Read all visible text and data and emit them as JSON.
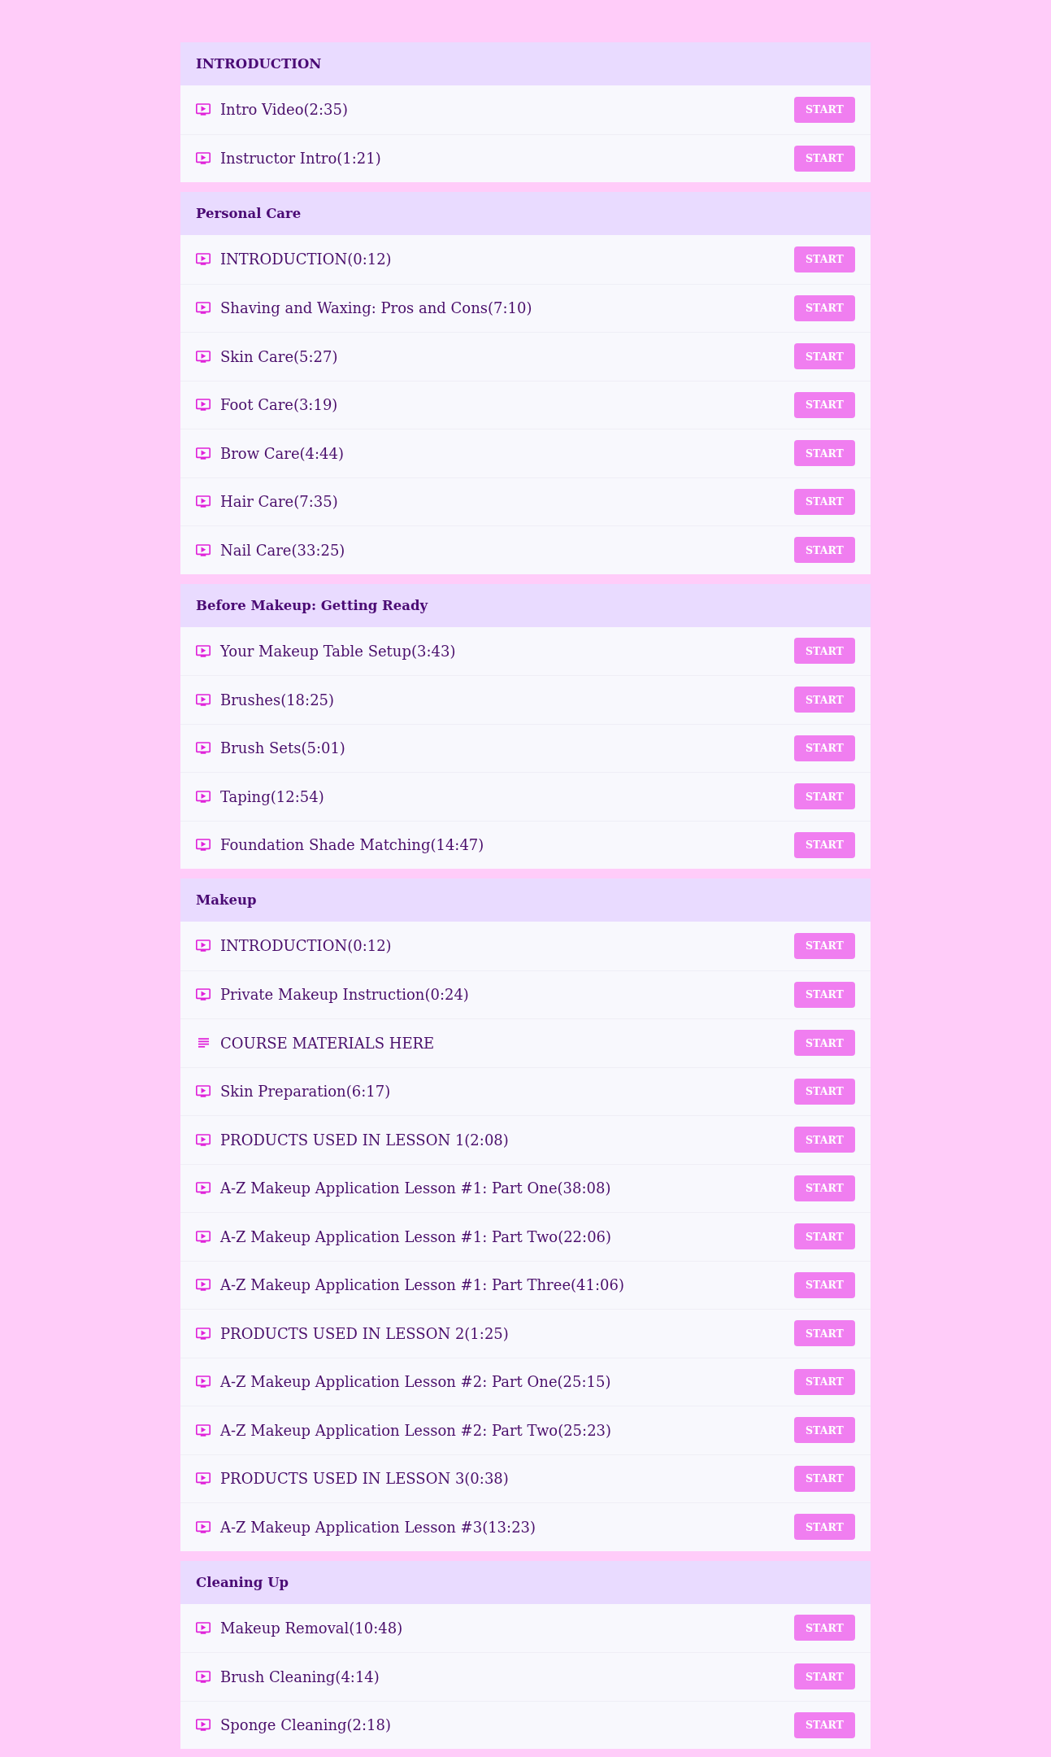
{
  "sections": [
    {
      "title": "INTRODUCTION",
      "lessons": [
        {
          "kind": "video",
          "title": "Intro Video(2:35)",
          "button": "START"
        },
        {
          "kind": "video",
          "title": "Instructor Intro(1:21)",
          "button": "START"
        }
      ]
    },
    {
      "title": "Personal Care",
      "lessons": [
        {
          "kind": "video",
          "title": "INTRODUCTION(0:12)",
          "button": "START"
        },
        {
          "kind": "video",
          "title": "Shaving and Waxing: Pros and Cons(7:10)",
          "button": "START"
        },
        {
          "kind": "video",
          "title": "Skin Care(5:27)",
          "button": "START"
        },
        {
          "kind": "video",
          "title": "Foot Care(3:19)",
          "button": "START"
        },
        {
          "kind": "video",
          "title": "Brow Care(4:44)",
          "button": "START"
        },
        {
          "kind": "video",
          "title": "Hair Care(7:35)",
          "button": "START"
        },
        {
          "kind": "video",
          "title": "Nail Care(33:25)",
          "button": "START"
        }
      ]
    },
    {
      "title": "Before Makeup: Getting Ready",
      "lessons": [
        {
          "kind": "video",
          "title": "Your Makeup Table Setup(3:43)",
          "button": "START"
        },
        {
          "kind": "video",
          "title": "Brushes(18:25)",
          "button": "START"
        },
        {
          "kind": "video",
          "title": "Brush Sets(5:01)",
          "button": "START"
        },
        {
          "kind": "video",
          "title": "Taping(12:54)",
          "button": "START"
        },
        {
          "kind": "video",
          "title": "Foundation Shade Matching(14:47)",
          "button": "START"
        }
      ]
    },
    {
      "title": "Makeup",
      "lessons": [
        {
          "kind": "video",
          "title": "INTRODUCTION(0:12)",
          "button": "START"
        },
        {
          "kind": "video",
          "title": "Private Makeup Instruction(0:24)",
          "button": "START"
        },
        {
          "kind": "text",
          "title": "COURSE MATERIALS HERE",
          "button": "START"
        },
        {
          "kind": "video",
          "title": "Skin Preparation(6:17)",
          "button": "START"
        },
        {
          "kind": "video",
          "title": "PRODUCTS USED IN LESSON 1(2:08)",
          "button": "START"
        },
        {
          "kind": "video",
          "title": "A-Z Makeup Application Lesson #1: Part One(38:08)",
          "button": "START"
        },
        {
          "kind": "video",
          "title": "A-Z Makeup Application Lesson #1: Part Two(22:06)",
          "button": "START"
        },
        {
          "kind": "video",
          "title": "A-Z Makeup Application Lesson #1: Part Three(41:06)",
          "button": "START"
        },
        {
          "kind": "video",
          "title": "PRODUCTS USED IN LESSON 2(1:25)",
          "button": "START"
        },
        {
          "kind": "video",
          "title": "A-Z Makeup Application Lesson #2: Part One(25:15)",
          "button": "START"
        },
        {
          "kind": "video",
          "title": "A-Z Makeup Application Lesson #2: Part Two(25:23)",
          "button": "START"
        },
        {
          "kind": "video",
          "title": "PRODUCTS USED IN LESSON 3(0:38)",
          "button": "START"
        },
        {
          "kind": "video",
          "title": "A-Z Makeup Application Lesson #3(13:23)",
          "button": "START"
        }
      ]
    },
    {
      "title": "Cleaning Up",
      "lessons": [
        {
          "kind": "video",
          "title": "Makeup Removal(10:48)",
          "button": "START"
        },
        {
          "kind": "video",
          "title": "Brush Cleaning(4:14)",
          "button": "START"
        },
        {
          "kind": "video",
          "title": "Sponge Cleaning(2:18)",
          "button": "START"
        }
      ]
    }
  ]
}
